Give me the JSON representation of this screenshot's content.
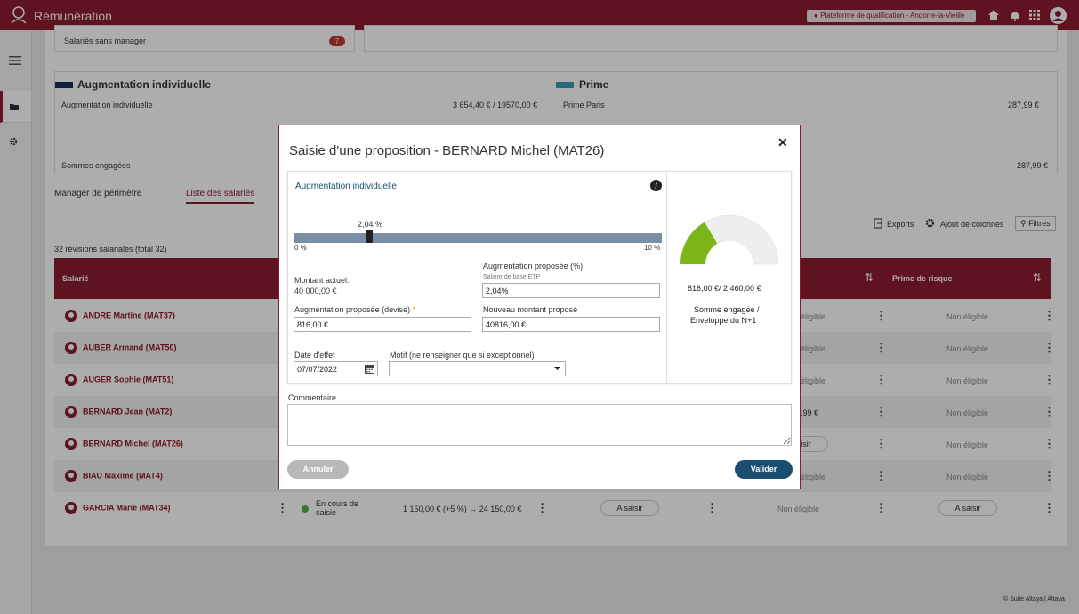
{
  "topbar": {
    "title": "Rémunération",
    "location": "Plateforme de qualification - Andorre-la-Vieille"
  },
  "summary": {
    "no_manager_label": "Salariés sans manager",
    "no_manager_count": "7",
    "aug_title": "Augmentation individuelle",
    "aug_row_label": "Augmentation individuelle",
    "aug_row_value": "3 654,40 € / 19570,00 €",
    "aug_footer": "Sommes engagées",
    "prime_title": "Prime",
    "prime_row_label": "Prime Paris",
    "prime_row_value": "287,99 €",
    "prime_footer_value": "287,99 €"
  },
  "tabs": [
    "Manager de périmètre",
    "Liste des salariés"
  ],
  "toolbar": {
    "exports": "Exports",
    "columns": "Ajout de colonnes",
    "filters": "Filtres"
  },
  "count": "32 révisions salariales (total 32)",
  "table": {
    "col_employee": "Salarié",
    "col_risk": "Prime de risque",
    "rows": [
      {
        "name": "ANDRE Martine (MAT37)",
        "mid": "éligible",
        "risk": "Non éligible"
      },
      {
        "name": "AUBER Armand (MAT50)",
        "mid": "éligible",
        "risk": "Non éligible"
      },
      {
        "name": "AUGER Sophie (MAT51)",
        "mid": "éligible",
        "risk": "Non éligible"
      },
      {
        "name": "BERNARD Jean (MAT2)",
        "mid": ",99 €",
        "risk": "Non éligible"
      },
      {
        "name": "BERNARD Michel (MAT26)",
        "mid": "isir",
        "risk": "Non éligible"
      },
      {
        "name": "BIAU Maxime (MAT4)",
        "mid": "éligible",
        "risk": "Non éligible"
      },
      {
        "name": "GARCIA Marie (MAT34)",
        "status": "En cours de saisie",
        "amount": "1 150,00 € (+5 %) → 24 150,00 €",
        "saisir": "A saisir",
        "mid": "Non éligible",
        "risk": "A saisir"
      }
    ]
  },
  "modal": {
    "title": "Saisie d'une proposition - BERNARD Michel (MAT26)",
    "section": "Augmentation individuelle",
    "slider": {
      "value_label": "2,04 %",
      "min_label": "0 %",
      "max_label": "10 %",
      "fraction": 0.204
    },
    "current_amount_label": "Montant actuel:",
    "current_amount_value": "40 000,00 €",
    "pct_label": "Augmentation proposée (%)",
    "base_label": "Salaire de base ETP",
    "pct_value": "2,04%",
    "currency_label": "Augmentation proposée (devise)",
    "required_mark": "*",
    "currency_value": "816,00 €",
    "new_amount_label": "Nouveau montant proposé",
    "new_amount_value": "40816,00 €",
    "date_label": "Date d'effet",
    "date_value": "07/07/2022",
    "motif_label": "Motif (ne renseigner que si exceptionnel)",
    "gauge_amount": "816,00 €/ 2 460,00 €",
    "gauge_caption_1": "Somme engagée /",
    "gauge_caption_2": "Enveloppe du N+1",
    "gauge_fraction": 0.33,
    "comment_label": "Commentaire",
    "cancel": "Annuler",
    "validate": "Valider"
  },
  "footer": "© Suite Altaya | Altaya",
  "colors": {
    "brand": "#8c1b2f",
    "gauge_fill": "#7cb518",
    "slider_track": "#7a8ea6",
    "validate": "#1a4d6e"
  }
}
